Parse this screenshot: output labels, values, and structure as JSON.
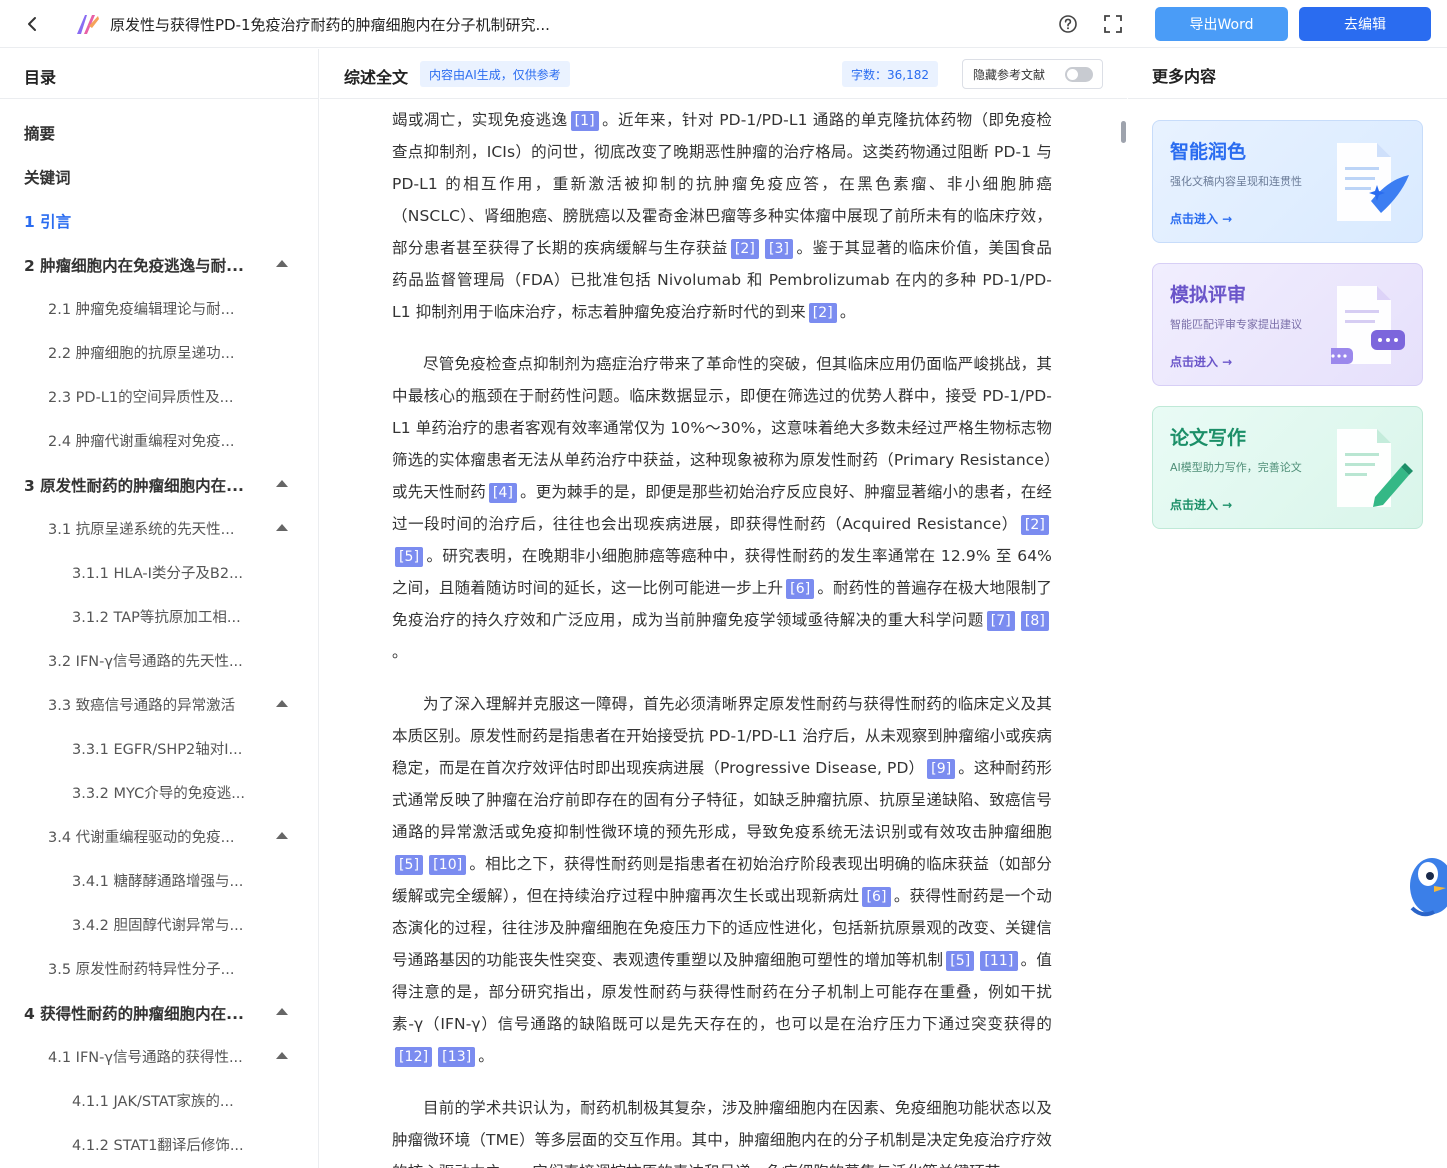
{
  "topbar": {
    "doc_title": "原发性与获得性PD-1免疫治疗耐药的肿瘤细胞内在分子机制研究...",
    "export_label": "导出Word",
    "edit_label": "去编辑"
  },
  "toc": {
    "heading": "目录",
    "items": [
      {
        "label": "摘要",
        "level": 1,
        "active": false,
        "arrow": false
      },
      {
        "label": "关键词",
        "level": 1,
        "active": false,
        "arrow": false
      },
      {
        "label": "1 引言",
        "level": 1,
        "active": true,
        "arrow": false
      },
      {
        "label": "2 肿瘤细胞内在免疫逃逸与耐...",
        "level": 1,
        "active": false,
        "arrow": true
      },
      {
        "label": "2.1 肿瘤免疫编辑理论与耐...",
        "level": 2,
        "active": false,
        "arrow": false
      },
      {
        "label": "2.2 肿瘤细胞的抗原呈递功...",
        "level": 2,
        "active": false,
        "arrow": false
      },
      {
        "label": "2.3 PD-L1的空间异质性及...",
        "level": 2,
        "active": false,
        "arrow": false
      },
      {
        "label": "2.4 肿瘤代谢重编程对免疫...",
        "level": 2,
        "active": false,
        "arrow": false
      },
      {
        "label": "3 原发性耐药的肿瘤细胞内在...",
        "level": 1,
        "active": false,
        "arrow": true
      },
      {
        "label": "3.1 抗原呈递系统的先天性...",
        "level": 2,
        "active": false,
        "arrow": true
      },
      {
        "label": "3.1.1 HLA-I类分子及B2...",
        "level": 3,
        "active": false,
        "arrow": false
      },
      {
        "label": "3.1.2 TAP等抗原加工相...",
        "level": 3,
        "active": false,
        "arrow": false
      },
      {
        "label": "3.2 IFN-γ信号通路的先天性...",
        "level": 2,
        "active": false,
        "arrow": false
      },
      {
        "label": "3.3 致癌信号通路的异常激活",
        "level": 2,
        "active": false,
        "arrow": true
      },
      {
        "label": "3.3.1 EGFR/SHP2轴对I...",
        "level": 3,
        "active": false,
        "arrow": false
      },
      {
        "label": "3.3.2 MYC介导的免疫逃...",
        "level": 3,
        "active": false,
        "arrow": false
      },
      {
        "label": "3.4 代谢重编程驱动的免疫...",
        "level": 2,
        "active": false,
        "arrow": true
      },
      {
        "label": "3.4.1 糖酵酵通路增强与...",
        "level": 3,
        "active": false,
        "arrow": false
      },
      {
        "label": "3.4.2 胆固醇代谢异常与...",
        "level": 3,
        "active": false,
        "arrow": false
      },
      {
        "label": "3.5 原发性耐药特异性分子...",
        "level": 2,
        "active": false,
        "arrow": false
      },
      {
        "label": "4 获得性耐药的肿瘤细胞内在...",
        "level": 1,
        "active": false,
        "arrow": true
      },
      {
        "label": "4.1 IFN-γ信号通路的获得性...",
        "level": 2,
        "active": false,
        "arrow": true
      },
      {
        "label": "4.1.1 JAK/STAT家族的...",
        "level": 3,
        "active": false,
        "arrow": false
      },
      {
        "label": "4.1.2 STAT1翻译后修饰...",
        "level": 3,
        "active": false,
        "arrow": false
      }
    ]
  },
  "center": {
    "title": "综述全文",
    "ai_badge": "内容由AI生成，仅供参考",
    "word_count": "字数：36,182",
    "hide_refs_label": "隐藏参考文献",
    "paragraphs": [
      {
        "first": true,
        "segments": [
          {
            "t": "竭或凋亡，实现免疫逃逸"
          },
          {
            "c": "[1]"
          },
          {
            "t": "。近年来，针对 PD-1/PD-L1 通路的单克隆抗体药物（即免疫检查点抑制剂，ICIs）的问世，彻底改变了晚期恶性肿瘤的治疗格局。这类药物通过阻断 PD-1 与 PD-L1 的相互作用，重新激活被抑制的抗肿瘤免疫应答，在黑色素瘤、非小细胞肺癌（NSCLC）、肾细胞癌、膀胱癌以及霍奇金淋巴瘤等多种实体瘤中展现了前所未有的临床疗效，部分患者甚至获得了长期的疾病缓解与生存获益"
          },
          {
            "c": "[2]"
          },
          {
            "c": "[3]"
          },
          {
            "t": "。鉴于其显著的临床价值，美国食品药品监督管理局（FDA）已批准包括 Nivolumab 和 Pembrolizumab 在内的多种 PD-1/PD-L1 抑制剂用于临床治疗，标志着肿瘤免疫治疗新时代的到来"
          },
          {
            "c": "[2]"
          },
          {
            "t": "。"
          }
        ]
      },
      {
        "first": false,
        "segments": [
          {
            "t": "尽管免疫检查点抑制剂为癌症治疗带来了革命性的突破，但其临床应用仍面临严峻挑战，其中最核心的瓶颈在于耐药性问题。临床数据显示，即便在筛选过的优势人群中，接受 PD-1/PD-L1 单药治疗的患者客观有效率通常仅为 10%～30%，这意味着绝大多数未经过严格生物标志物筛选的实体瘤患者无法从单药治疗中获益，这种现象被称为原发性耐药（Primary Resistance）或先天性耐药"
          },
          {
            "c": "[4]"
          },
          {
            "t": "。更为棘手的是，即便是那些初始治疗反应良好、肿瘤显著缩小的患者，在经过一段时间的治疗后，往往也会出现疾病进展，即获得性耐药（Acquired Resistance）"
          },
          {
            "c": "[2]"
          },
          {
            "c": "[5]"
          },
          {
            "t": "。研究表明，在晚期非小细胞肺癌等癌种中，获得性耐药的发生率通常在 12.9% 至 64% 之间，且随着随访时间的延长，这一比例可能进一步上升"
          },
          {
            "c": "[6]"
          },
          {
            "t": "。耐药性的普遍存在极大地限制了免疫治疗的持久疗效和广泛应用，成为当前肿瘤免疫学领域亟待解决的重大科学问题"
          },
          {
            "c": "[7]"
          },
          {
            "c": "[8]"
          },
          {
            "t": "。"
          }
        ]
      },
      {
        "first": false,
        "segments": [
          {
            "t": "为了深入理解并克服这一障碍，首先必须清晰界定原发性耐药与获得性耐药的临床定义及其本质区别。原发性耐药是指患者在开始接受抗 PD-1/PD-L1 治疗后，从未观察到肿瘤缩小或疾病稳定，而是在首次疗效评估时即出现疾病进展（Progressive Disease, PD）"
          },
          {
            "c": "[9]"
          },
          {
            "t": "。这种耐药形式通常反映了肿瘤在治疗前即存在的固有分子特征，如缺乏肿瘤抗原、抗原呈递缺陷、致癌信号通路的异常激活或免疫抑制性微环境的预先形成，导致免疫系统无法识别或有效攻击肿瘤细胞"
          },
          {
            "c": "[5]"
          },
          {
            "c": "[10]"
          },
          {
            "t": "。相比之下，获得性耐药则是指患者在初始治疗阶段表现出明确的临床获益（如部分缓解或完全缓解），但在持续治疗过程中肿瘤再次生长或出现新病灶"
          },
          {
            "c": "[6]"
          },
          {
            "t": "。获得性耐药是一个动态演化的过程，往往涉及肿瘤细胞在免疫压力下的适应性进化，包括新抗原景观的改变、关键信号通路基因的功能丧失性突变、表观遗传重塑以及肿瘤细胞可塑性的增加等机制"
          },
          {
            "c": "[5]"
          },
          {
            "c": "[11]"
          },
          {
            "t": "。值得注意的是，部分研究指出，原发性耐药与获得性耐药在分子机制上可能存在重叠，例如干扰素-γ（IFN-γ）信号通路的缺陷既可以是先天存在的，也可以是在治疗压力下通过突变获得的"
          },
          {
            "c": "[12]"
          },
          {
            "c": "[13]"
          },
          {
            "t": "。"
          }
        ]
      },
      {
        "first": false,
        "segments": [
          {
            "t": "目前的学术共识认为，耐药机制极其复杂，涉及肿瘤细胞内在因素、免疫细胞功能状态以及肿瘤微环境（TME）等多层面的交互作用。其中，肿瘤细胞内在的分子机制是决定免疫治疗疗效的核心驱动力之一，它们直接调控抗原的表达和呈递、免疫细胞的募集与活化等关键环节。"
          }
        ]
      }
    ]
  },
  "right": {
    "heading": "更多内容",
    "cards": [
      {
        "title": "智能润色",
        "desc": "强化文稿内容呈现和连贯性",
        "link": "点击进入 →"
      },
      {
        "title": "模拟评审",
        "desc": "智能匹配评审专家提出建议",
        "link": "点击进入 →"
      },
      {
        "title": "论文写作",
        "desc": "AI模型助力写作，完善论文",
        "link": "点击进入 →"
      }
    ]
  },
  "icons": {
    "back": "chevron-left-icon",
    "help": "question-circle-icon",
    "fullscreen": "fullscreen-icon"
  },
  "colors": {
    "accent": "#2a6cf0",
    "export_button": "#4a9cf7",
    "citation": "#7b8cf0"
  }
}
